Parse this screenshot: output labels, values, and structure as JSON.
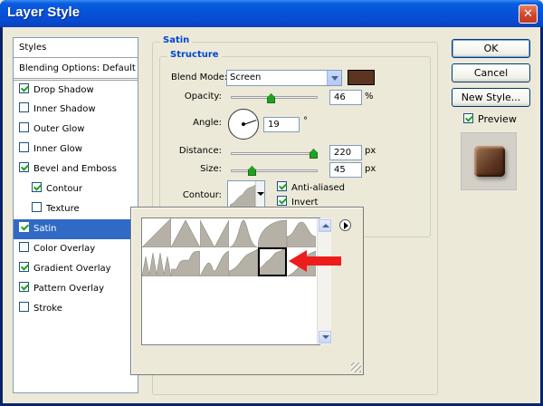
{
  "window": {
    "title": "Layer Style",
    "close_label": "✕"
  },
  "styles_list": {
    "header": "Styles",
    "blending": "Blending Options: Default",
    "items": [
      {
        "label": "Drop Shadow",
        "checked": true,
        "indent": false,
        "selected": false
      },
      {
        "label": "Inner Shadow",
        "checked": false,
        "indent": false,
        "selected": false
      },
      {
        "label": "Outer Glow",
        "checked": false,
        "indent": false,
        "selected": false
      },
      {
        "label": "Inner Glow",
        "checked": false,
        "indent": false,
        "selected": false
      },
      {
        "label": "Bevel and Emboss",
        "checked": true,
        "indent": false,
        "selected": false
      },
      {
        "label": "Contour",
        "checked": true,
        "indent": true,
        "selected": false
      },
      {
        "label": "Texture",
        "checked": false,
        "indent": true,
        "selected": false
      },
      {
        "label": "Satin",
        "checked": true,
        "indent": false,
        "selected": true
      },
      {
        "label": "Color Overlay",
        "checked": false,
        "indent": false,
        "selected": false
      },
      {
        "label": "Gradient Overlay",
        "checked": true,
        "indent": false,
        "selected": false
      },
      {
        "label": "Pattern Overlay",
        "checked": true,
        "indent": false,
        "selected": false
      },
      {
        "label": "Stroke",
        "checked": false,
        "indent": false,
        "selected": false
      }
    ]
  },
  "satin": {
    "group_title": "Satin",
    "structure_title": "Structure",
    "blend_mode_label": "Blend Mode:",
    "blend_mode_value": "Screen",
    "satin_color": "#5b3520",
    "opacity_label": "Opacity:",
    "opacity_value": "46",
    "opacity_unit": "%",
    "angle_label": "Angle:",
    "angle_value": "19",
    "angle_unit": "°",
    "distance_label": "Distance:",
    "distance_value": "220",
    "distance_unit": "px",
    "size_label": "Size:",
    "size_value": "45",
    "size_unit": "px",
    "contour_label": "Contour:",
    "anti_aliased_label": "Anti-aliased",
    "anti_aliased_checked": true,
    "invert_label": "Invert",
    "invert_checked": true
  },
  "buttons": {
    "ok": "OK",
    "cancel": "Cancel",
    "new_style": "New Style...",
    "preview_label": "Preview",
    "preview_checked": true
  },
  "contour_picker": {
    "presets": [
      "linear",
      "cone",
      "cone-inverted",
      "gaussian",
      "half-round",
      "ring",
      "ring-double",
      "rounded-steps",
      "sawtooth",
      "cove-deep",
      "cove-shallow",
      "rolling-slope"
    ],
    "selected_index": 10
  },
  "colors": {
    "title_bar": "#0a5ee0",
    "selection": "#316ac5",
    "contour_fill": "#b5b1a7",
    "arrow": "#ee1c1c"
  }
}
